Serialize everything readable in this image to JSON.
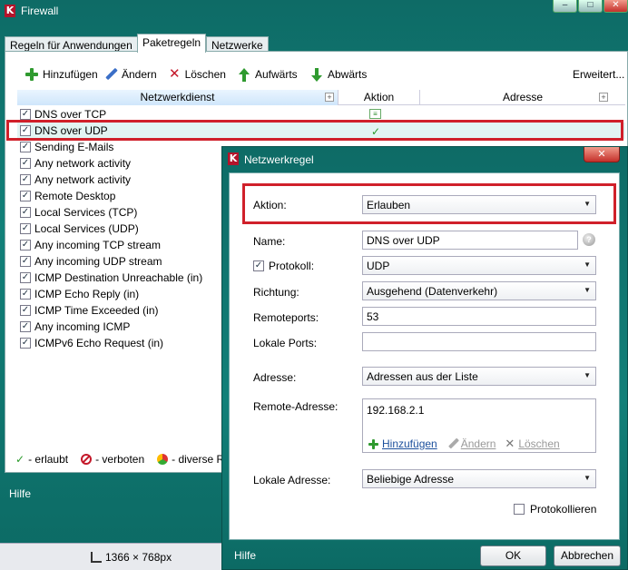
{
  "window": {
    "title": "Firewall",
    "app_logo": "K"
  },
  "tabs": [
    {
      "label": "Regeln für Anwendungen"
    },
    {
      "label": "Paketregeln"
    },
    {
      "label": "Netzwerke"
    }
  ],
  "toolbar": {
    "add_label": "Hinzufügen",
    "edit_label": "Ändern",
    "delete_label": "Löschen",
    "up_label": "Aufwärts",
    "down_label": "Abwärts",
    "advanced_label": "Erweitert..."
  },
  "grid": {
    "columns": [
      "Netzwerkdienst",
      "Aktion",
      "Adresse"
    ],
    "rows": [
      {
        "name": "DNS over TCP",
        "checked": true,
        "action": ""
      },
      {
        "name": "DNS over UDP",
        "checked": true,
        "action": "✓"
      },
      {
        "name": "Sending E-Mails",
        "checked": true,
        "action": ""
      },
      {
        "name": "Any network activity",
        "checked": true,
        "action": ""
      },
      {
        "name": "Any network activity",
        "checked": true,
        "action": ""
      },
      {
        "name": "Remote Desktop",
        "checked": true,
        "action": ""
      },
      {
        "name": "Local Services (TCP)",
        "checked": true,
        "action": ""
      },
      {
        "name": "Local Services (UDP)",
        "checked": true,
        "action": ""
      },
      {
        "name": "Any incoming TCP stream",
        "checked": true,
        "action": ""
      },
      {
        "name": "Any incoming UDP stream",
        "checked": true,
        "action": ""
      },
      {
        "name": "ICMP Destination Unreachable (in)",
        "checked": true,
        "action": ""
      },
      {
        "name": "ICMP Echo Reply (in)",
        "checked": true,
        "action": ""
      },
      {
        "name": "ICMP Time Exceeded (in)",
        "checked": true,
        "action": ""
      },
      {
        "name": "Any incoming ICMP",
        "checked": true,
        "action": ""
      },
      {
        "name": "ICMPv6 Echo Request (in)",
        "checked": true,
        "action": ""
      }
    ]
  },
  "legend": {
    "allowed": "- erlaubt",
    "forbidden": "- verboten",
    "mixed": "- diverse Re"
  },
  "footer": {
    "help": "Hilfe"
  },
  "statusbar": {
    "resolution": "1366 × 768px"
  },
  "dialog": {
    "title": "Netzwerkregel",
    "logo": "K",
    "close": "✕",
    "aktion": {
      "label": "Aktion:",
      "value": "Erlauben"
    },
    "name": {
      "label": "Name:",
      "value": "DNS over UDP"
    },
    "protokoll": {
      "label": "Protokoll:",
      "value": "UDP",
      "checked": true
    },
    "richtung": {
      "label": "Richtung:",
      "value": "Ausgehend (Datenverkehr)"
    },
    "remoteports": {
      "label": "Remoteports:",
      "value": "53"
    },
    "lokale_ports": {
      "label": "Lokale Ports:",
      "value": ""
    },
    "adresse": {
      "label": "Adresse:",
      "value": "Adressen aus der Liste"
    },
    "remote_adresse": {
      "label": "Remote-Adresse:",
      "items": [
        "192.168.2.1"
      ],
      "add_label": "Hinzufügen",
      "edit_label": "Ändern",
      "delete_label": "Löschen"
    },
    "lokale_adresse": {
      "label": "Lokale Adresse:",
      "value": "Beliebige Adresse"
    },
    "protokollieren": {
      "label": "Protokollieren",
      "checked": false
    },
    "help": "Hilfe",
    "ok": "OK",
    "cancel": "Abbrechen"
  },
  "colors": {
    "window_teal": "#128079",
    "highlight_red": "#d0202a",
    "allowed_green": "#2a9a2a",
    "selected_row": "#e2f4f2"
  }
}
